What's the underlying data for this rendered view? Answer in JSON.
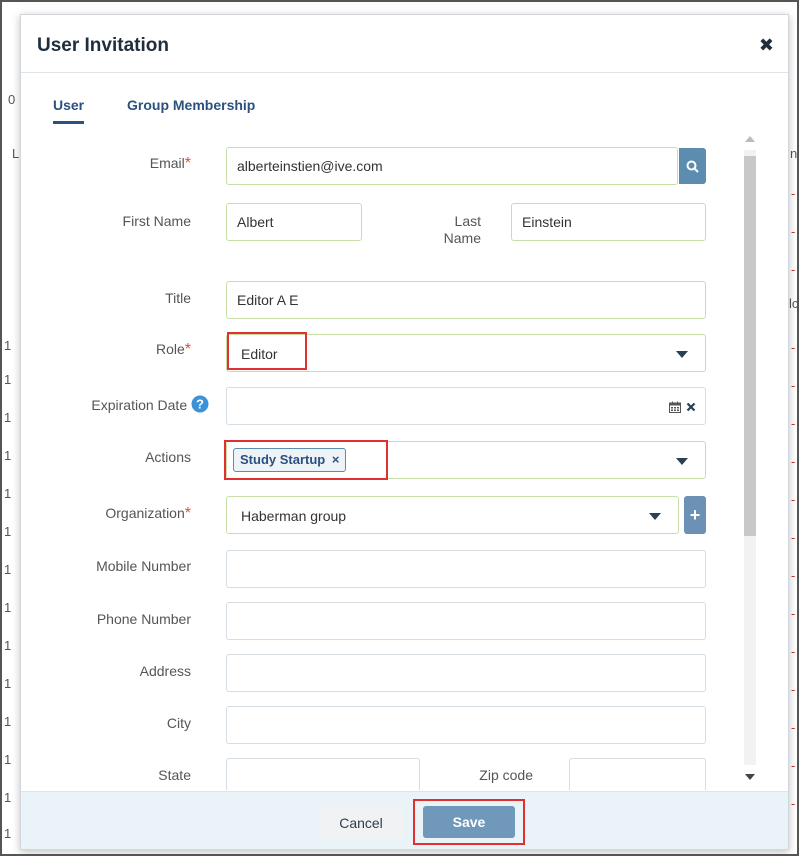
{
  "background": {
    "left_chars": [
      "0",
      "L",
      "1",
      "1",
      "1",
      "1",
      "1",
      "1",
      "1",
      "1",
      "1",
      "1",
      "1",
      "1",
      "1",
      "1",
      "1"
    ],
    "right_chars": [
      "n",
      "n",
      "-",
      "-",
      "-",
      "lc",
      "-",
      "-",
      "-",
      "-",
      "-",
      "-",
      "-",
      "-",
      "-",
      "-",
      "-",
      "-",
      "-",
      "-",
      "-"
    ]
  },
  "dialog": {
    "title": "User Invitation",
    "close_glyph": "✖"
  },
  "tabs": [
    {
      "label": "User",
      "active": true
    },
    {
      "label": "Group Membership",
      "active": false
    }
  ],
  "form": {
    "email": {
      "label": "Email",
      "value": "alberteinstien@ive.com",
      "required": true
    },
    "first_name": {
      "label": "First Name",
      "value": "Albert"
    },
    "last_name": {
      "label": "Last Name",
      "value": "Einstein"
    },
    "title": {
      "label": "Title",
      "value": "Editor A E"
    },
    "role": {
      "label": "Role",
      "value": "Editor",
      "required": true
    },
    "expiration_date": {
      "label": "Expiration Date",
      "value": "",
      "help_icon": "question-circle-icon"
    },
    "actions": {
      "label": "Actions",
      "tags": [
        "Study Startup"
      ]
    },
    "organization": {
      "label": "Organization",
      "value": "Haberman group",
      "required": true
    },
    "mobile_number": {
      "label": "Mobile Number",
      "value": ""
    },
    "phone_number": {
      "label": "Phone Number",
      "value": ""
    },
    "address": {
      "label": "Address",
      "value": ""
    },
    "city": {
      "label": "City",
      "value": ""
    },
    "state": {
      "label": "State",
      "value": ""
    },
    "zip_code": {
      "label": "Zip code",
      "value": ""
    },
    "required_marker": "*"
  },
  "footer": {
    "cancel_label": "Cancel",
    "save_label": "Save"
  },
  "colors": {
    "accent": "#2a5180",
    "highlight": "#e03030",
    "field_border": "#c8e0a8",
    "save_button": "#6f98ba"
  }
}
